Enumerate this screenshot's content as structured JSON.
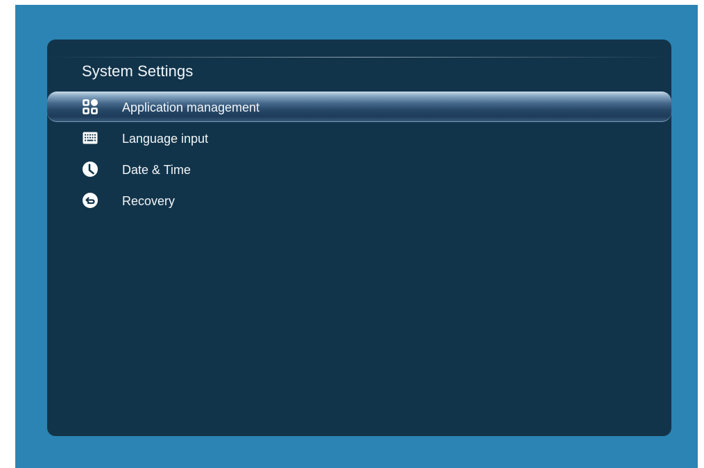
{
  "panel": {
    "title": "System Settings"
  },
  "menu": {
    "selected_index": 0,
    "items": [
      {
        "label": "Application management",
        "icon": "apps-grid-icon"
      },
      {
        "label": "Language input",
        "icon": "keyboard-icon"
      },
      {
        "label": "Date & Time",
        "icon": "clock-icon"
      },
      {
        "label": "Recovery",
        "icon": "recovery-icon"
      }
    ]
  },
  "colors": {
    "background": "#2b84b3",
    "panel": "#12344a",
    "text": "#f2f6f9"
  }
}
